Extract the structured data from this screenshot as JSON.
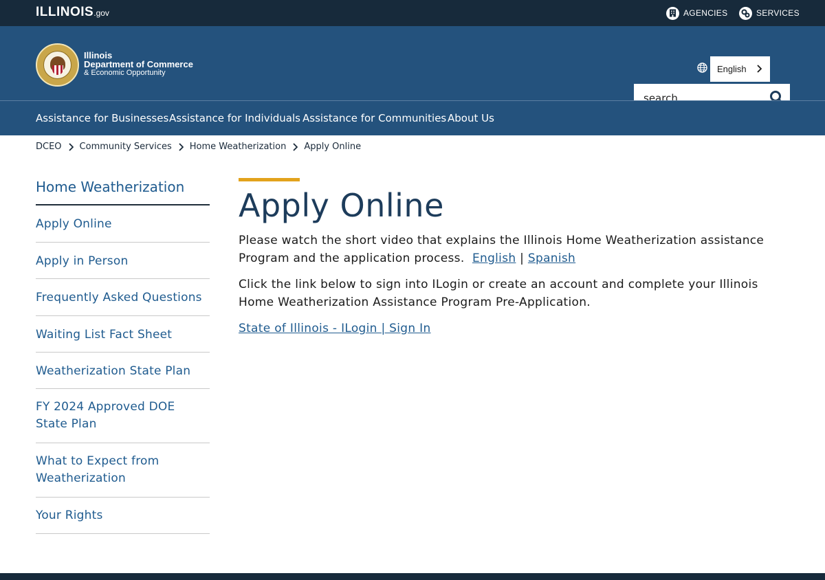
{
  "topbar": {
    "logo_main": "ILLINOIS",
    "logo_suffix": ".gov",
    "agencies": "AGENCIES",
    "services": "SERVICES"
  },
  "header": {
    "dept_line1": "Illinois",
    "dept_line2": "Department of Commerce",
    "dept_line3": "& Economic Opportunity",
    "language": "English",
    "search_placeholder": "search"
  },
  "nav": {
    "items": [
      {
        "label": "Assistance for Businesses"
      },
      {
        "label": "Assistance for Individuals"
      },
      {
        "label": "Assistance for Communities"
      },
      {
        "label": "About Us"
      }
    ]
  },
  "breadcrumb": [
    {
      "label": "DCEO"
    },
    {
      "label": "Community Services"
    },
    {
      "label": "Home Weatherization"
    },
    {
      "label": "Apply Online"
    }
  ],
  "sidebar": {
    "title": "Home Weatherization",
    "items": [
      {
        "label": "Apply Online"
      },
      {
        "label": "Apply in Person"
      },
      {
        "label": "Frequently Asked Questions"
      },
      {
        "label": "Waiting List Fact Sheet"
      },
      {
        "label": "Weatherization State Plan"
      },
      {
        "label": "FY 2024 Approved DOE State Plan"
      },
      {
        "label": "What to Expect from Weatherization"
      },
      {
        "label": "Your Rights"
      }
    ]
  },
  "main": {
    "title": "Apply Online",
    "para1_text": "Please watch the short video that explains the Illinois Home Weatherization assistance Program and the application process.",
    "link_english": "English",
    "link_separator": "|",
    "link_spanish": "Spanish",
    "para2_text": "Click the link below to sign into ILogin  or create an account and complete your Illinois Home Weatherization Assistance Program Pre-Application.",
    "ilogin_link": "State of Illinois - ILogin | Sign In"
  },
  "colors": {
    "topbar": "#172a3b",
    "header": "#24527d",
    "accent": "#e2a31c",
    "link": "#1f5b8f"
  }
}
